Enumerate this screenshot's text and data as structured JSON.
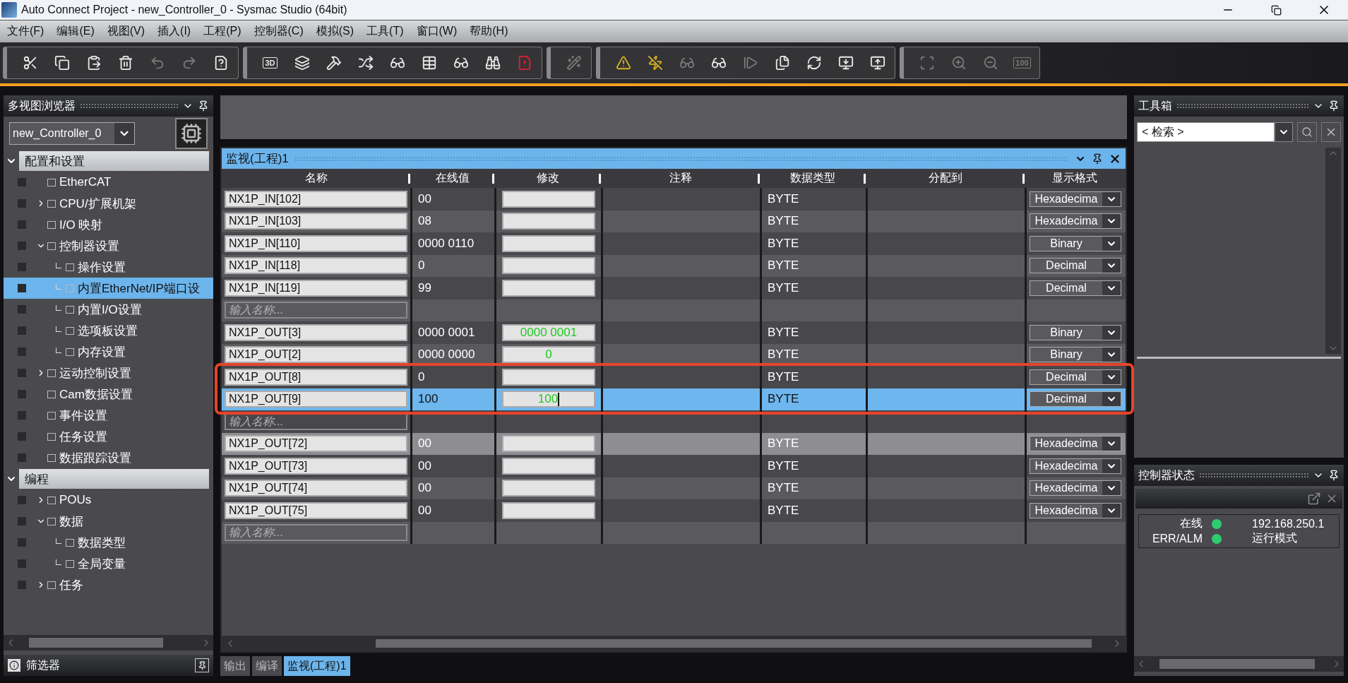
{
  "window": {
    "title": "Auto Connect Project - new_Controller_0 - Sysmac Studio (64bit)"
  },
  "menu": [
    "文件(F)",
    "编辑(E)",
    "视图(V)",
    "插入(I)",
    "工程(P)",
    "控制器(C)",
    "模拟(S)",
    "工具(T)",
    "窗口(W)",
    "帮助(H)"
  ],
  "toolbar": {
    "groups": [
      [
        {
          "disabled": false
        },
        {
          "disabled": false
        },
        {
          "disabled": false
        },
        {
          "disabled": false
        },
        {
          "disabled": true
        },
        {
          "disabled": true
        },
        {
          "disabled": false
        }
      ],
      [
        {
          "disabled": false,
          "label": "3D"
        },
        {
          "disabled": false
        },
        {
          "disabled": false
        },
        {
          "disabled": false
        },
        {
          "disabled": false
        },
        {
          "disabled": false
        },
        {
          "disabled": false
        },
        {
          "disabled": false
        },
        {
          "disabled": false
        }
      ],
      [
        {
          "disabled": true
        }
      ],
      [
        {
          "disabled": false
        },
        {
          "disabled": false
        },
        {
          "disabled": true
        },
        {
          "disabled": false
        },
        {
          "disabled": true
        },
        {
          "disabled": false
        },
        {
          "disabled": false
        },
        {
          "disabled": false
        },
        {
          "disabled": false
        }
      ],
      [
        {
          "disabled": true
        },
        {
          "disabled": true
        },
        {
          "disabled": true
        },
        {
          "disabled": true,
          "label": "100"
        }
      ]
    ]
  },
  "explorer": {
    "title": "多视图浏览器",
    "controller": "new_Controller_0",
    "sections": [
      {
        "label": "配置和设置",
        "expanded": true,
        "children": [
          {
            "label": "EtherCAT",
            "selected": false
          },
          {
            "label": "CPU/扩展机架",
            "selected": false,
            "expanded": false
          },
          {
            "label": "I/O 映射",
            "selected": false
          },
          {
            "label": "控制器设置",
            "selected": false,
            "expanded": true,
            "children": [
              {
                "label": "操作设置",
                "selected": false
              },
              {
                "label": "内置EtherNet/IP端口设",
                "selected": true
              },
              {
                "label": "内置I/O设置",
                "selected": false
              },
              {
                "label": "选项板设置",
                "selected": false
              },
              {
                "label": "内存设置",
                "selected": false
              }
            ]
          },
          {
            "label": "运动控制设置",
            "selected": false,
            "expanded": false
          },
          {
            "label": "Cam数据设置",
            "selected": false
          },
          {
            "label": "事件设置",
            "selected": false
          },
          {
            "label": "任务设置",
            "selected": false
          },
          {
            "label": "数据跟踪设置",
            "selected": false
          }
        ]
      },
      {
        "label": "编程",
        "expanded": true,
        "children": [
          {
            "label": "POUs",
            "selected": false,
            "expanded": false
          },
          {
            "label": "数据",
            "selected": false,
            "expanded": true,
            "children": [
              {
                "label": "数据类型",
                "selected": false
              },
              {
                "label": "全局变量",
                "selected": false
              }
            ]
          },
          {
            "label": "任务",
            "selected": false,
            "expanded": false
          }
        ]
      }
    ],
    "filter": "筛选器"
  },
  "monitor": {
    "title": "监视(工程)1",
    "columns": [
      "名称",
      "在线值",
      "修改",
      "注释",
      "数据类型",
      "分配到",
      "显示格式"
    ],
    "rows": [
      {
        "kind": "var",
        "name": "NX1P_IN[102]",
        "online": "00",
        "modify": "",
        "data_type": "BYTE",
        "format": "Hexadecima",
        "selected": false,
        "hover": false,
        "circled": false
      },
      {
        "kind": "var",
        "name": "NX1P_IN[103]",
        "online": "08",
        "modify": "",
        "data_type": "BYTE",
        "format": "Hexadecima",
        "selected": false,
        "hover": false,
        "circled": false
      },
      {
        "kind": "var",
        "name": "NX1P_IN[110]",
        "online": "0000 0110",
        "modify": "",
        "data_type": "BYTE",
        "format": "Binary",
        "selected": false,
        "hover": false,
        "circled": false
      },
      {
        "kind": "var",
        "name": "NX1P_IN[118]",
        "online": "0",
        "modify": "",
        "data_type": "BYTE",
        "format": "Decimal",
        "selected": false,
        "hover": false,
        "circled": false
      },
      {
        "kind": "var",
        "name": "NX1P_IN[119]",
        "online": "99",
        "modify": "",
        "data_type": "BYTE",
        "format": "Decimal",
        "selected": false,
        "hover": false,
        "circled": false
      },
      {
        "kind": "input",
        "placeholder": "输入名称...",
        "circled": false
      },
      {
        "kind": "var",
        "name": "NX1P_OUT[3]",
        "online": "0000 0001",
        "modify": "0000 0001",
        "data_type": "BYTE",
        "format": "Binary",
        "selected": false,
        "hover": false,
        "circled": false
      },
      {
        "kind": "var",
        "name": "NX1P_OUT[2]",
        "online": "0000 0000",
        "modify": "0",
        "data_type": "BYTE",
        "format": "Binary",
        "selected": false,
        "hover": false,
        "circled": false
      },
      {
        "kind": "var",
        "name": "NX1P_OUT[8]",
        "online": "0",
        "modify": "",
        "data_type": "BYTE",
        "format": "Decimal",
        "selected": false,
        "hover": false,
        "circled": true
      },
      {
        "kind": "var",
        "name": "NX1P_OUT[9]",
        "online": "100",
        "modify": "100",
        "data_type": "BYTE",
        "format": "Decimal",
        "selected": true,
        "hover": false,
        "circled": true
      },
      {
        "kind": "input",
        "placeholder": "输入名称...",
        "circled": false
      },
      {
        "kind": "var",
        "name": "NX1P_OUT[72]",
        "online": "00",
        "modify": "",
        "data_type": "BYTE",
        "format": "Hexadecima",
        "selected": false,
        "hover": true,
        "circled": false
      },
      {
        "kind": "var",
        "name": "NX1P_OUT[73]",
        "online": "00",
        "modify": "",
        "data_type": "BYTE",
        "format": "Hexadecima",
        "selected": false,
        "hover": false,
        "circled": false
      },
      {
        "kind": "var",
        "name": "NX1P_OUT[74]",
        "online": "00",
        "modify": "",
        "data_type": "BYTE",
        "format": "Hexadecima",
        "selected": false,
        "hover": false,
        "circled": false
      },
      {
        "kind": "var",
        "name": "NX1P_OUT[75]",
        "online": "00",
        "modify": "",
        "data_type": "BYTE",
        "format": "Hexadecima",
        "selected": false,
        "hover": false,
        "circled": false
      },
      {
        "kind": "input",
        "placeholder": "输入名称...",
        "circled": false
      }
    ]
  },
  "bottom_tabs": [
    {
      "label": "输出",
      "selected": false
    },
    {
      "label": "编译",
      "selected": false
    },
    {
      "label": "监视(工程)1",
      "selected": true
    }
  ],
  "toolbox": {
    "title": "工具箱",
    "search": "< 检索 >"
  },
  "controller_status": {
    "title": "控制器状态",
    "items": [
      {
        "label": "在线",
        "color": "#2ecc71",
        "value": "192.168.250.1"
      },
      {
        "label": "ERR/ALM",
        "color": "#2ecc71",
        "value": "运行模式"
      }
    ]
  }
}
